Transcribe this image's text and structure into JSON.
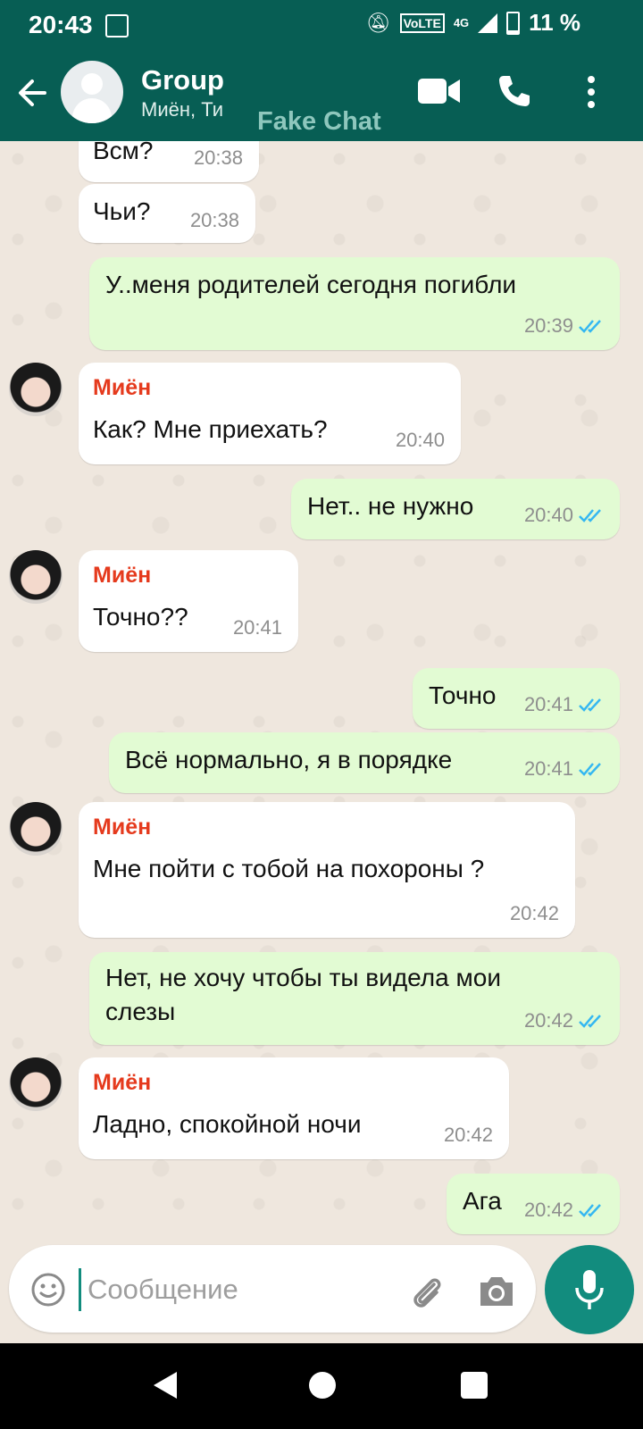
{
  "status_bar": {
    "time": "20:43",
    "volte": "VoLTE",
    "network": "4G",
    "battery": "11 %"
  },
  "header": {
    "title": "Group",
    "subtitle": "Миён, Ти",
    "watermark": "Fake Chat"
  },
  "messages": [
    {
      "dir": "in",
      "text": "Всм?",
      "time": "20:38"
    },
    {
      "dir": "in",
      "text": "Чьи?",
      "time": "20:38"
    },
    {
      "dir": "out",
      "text": "У..меня родителей сегодня погибли",
      "time": "20:39"
    },
    {
      "dir": "in",
      "sender": "Миён",
      "text": "Как? Мне приехать?",
      "time": "20:40"
    },
    {
      "dir": "out",
      "text": "Нет.. не нужно",
      "time": "20:40"
    },
    {
      "dir": "in",
      "sender": "Миён",
      "text": "Точно??",
      "time": "20:41"
    },
    {
      "dir": "out",
      "text": "Точно",
      "time": "20:41"
    },
    {
      "dir": "out",
      "text": "Всё нормально, я в порядке",
      "time": "20:41"
    },
    {
      "dir": "in",
      "sender": "Миён",
      "text": "Мне пойти с тобой на похороны ?",
      "time": "20:42"
    },
    {
      "dir": "out",
      "text_lines": [
        "Нет, не хочу чтобы ты видела мои",
        "слезы"
      ],
      "time": "20:42"
    },
    {
      "dir": "in",
      "sender": "Миён",
      "text": "Ладно, спокойной ночи",
      "time": "20:42"
    },
    {
      "dir": "out",
      "text": "Ага",
      "time": "20:42"
    }
  ],
  "composer": {
    "placeholder": "Сообщение",
    "value": ""
  },
  "colors": {
    "header": "#075e54",
    "accent": "#128c7e",
    "sender_name": "#e53a1d",
    "outgoing_bubble": "#e2fbd3",
    "read_ticks": "#34b7f1"
  },
  "icons": [
    "arrow-back-icon",
    "video-call-icon",
    "voice-call-icon",
    "more-vert-icon",
    "emoji-icon",
    "attach-icon",
    "camera-icon",
    "mic-icon",
    "double-check-icon"
  ]
}
